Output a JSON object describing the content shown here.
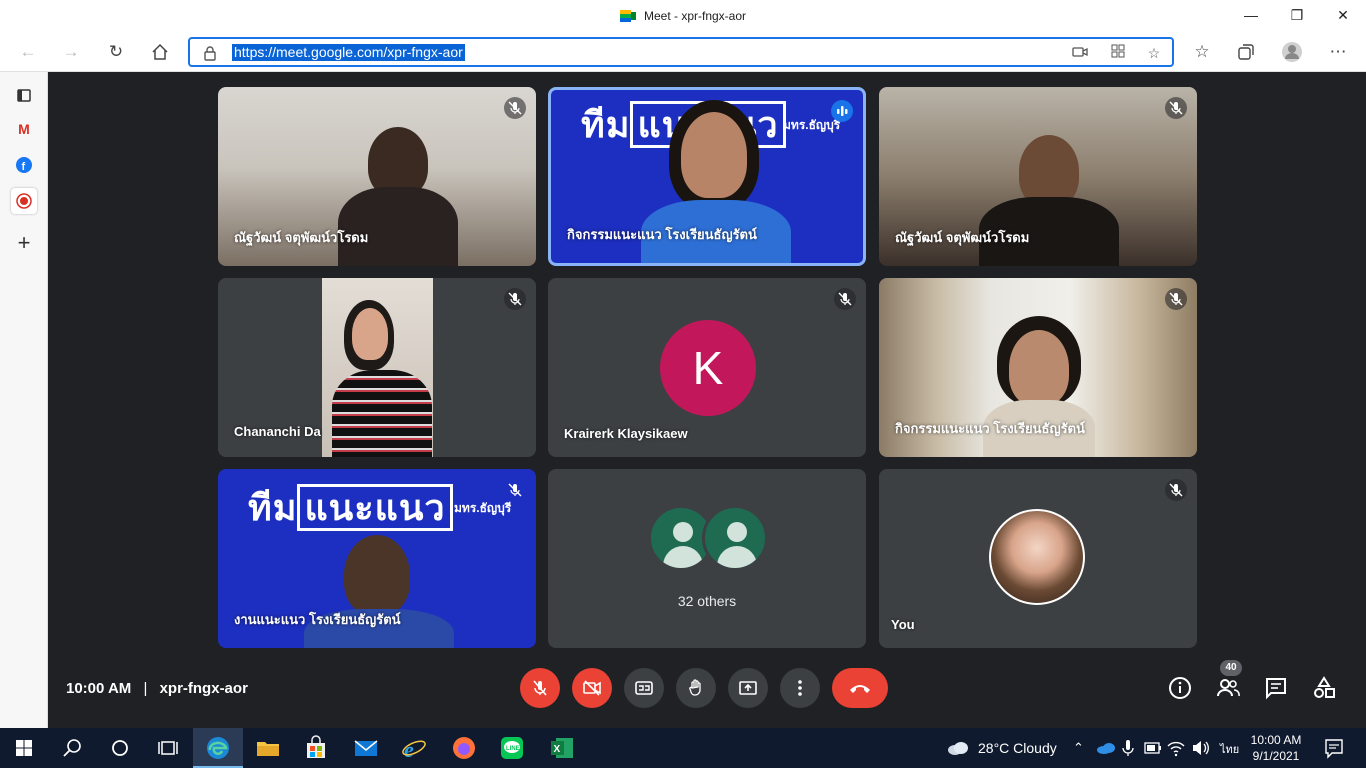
{
  "window": {
    "title": "Meet - xpr-fngx-aor",
    "minimize": "—",
    "restore": "❐",
    "close": "✕"
  },
  "browser": {
    "url": "https://meet.google.com/xpr-fngx-aor",
    "nav_icons": [
      "back-icon",
      "forward-icon",
      "refresh-icon",
      "home-icon"
    ],
    "url_icons": [
      "camera-icon",
      "apps-icon",
      "add-favorite-icon"
    ],
    "toolbar_icons": [
      "favorites-icon",
      "collections-icon",
      "profile-icon",
      "more-icon"
    ]
  },
  "sidebar": {
    "items": [
      "tabs-icon",
      "gmail-icon",
      "facebook-icon",
      "record-icon",
      "add-icon"
    ]
  },
  "tiles": [
    {
      "name": "ณัฐวัฒน์ จตุพัฒน์วโรดม",
      "muted": true
    },
    {
      "name": "กิจกรรมแนะแนว โรงเรียนธัญรัตน์",
      "muted": false,
      "speaking": true,
      "banner_a": "ทีม",
      "banner_b": "แนะแนว",
      "banner_sub": "มทร.ธัญบุรี"
    },
    {
      "name": "ณัฐวัฒน์ จตุพัฒน์วโรดม",
      "muted": true
    },
    {
      "name": "Chananchi Da",
      "muted": true
    },
    {
      "name": "Krairerk Klaysikaew",
      "muted": true,
      "initial": "K"
    },
    {
      "name": "กิจกรรมแนะแนว โรงเรียนธัญรัตน์",
      "muted": true
    },
    {
      "name": "งานแนะแนว โรงเรียนธัญรัตน์",
      "muted": true,
      "banner_a": "ทีม",
      "banner_b": "แนะแนว",
      "banner_sub": "มทร.ธัญบุรี"
    },
    {
      "name": "32 others"
    },
    {
      "name": "You",
      "muted": true
    }
  ],
  "bottom": {
    "time": "10:00 AM",
    "separator": "|",
    "meeting_code": "xpr-fngx-aor",
    "participants_count": "40"
  },
  "taskbar": {
    "weather": "28°C  Cloudy",
    "language": "ไทย",
    "time": "10:00 AM",
    "date": "9/1/2021"
  }
}
